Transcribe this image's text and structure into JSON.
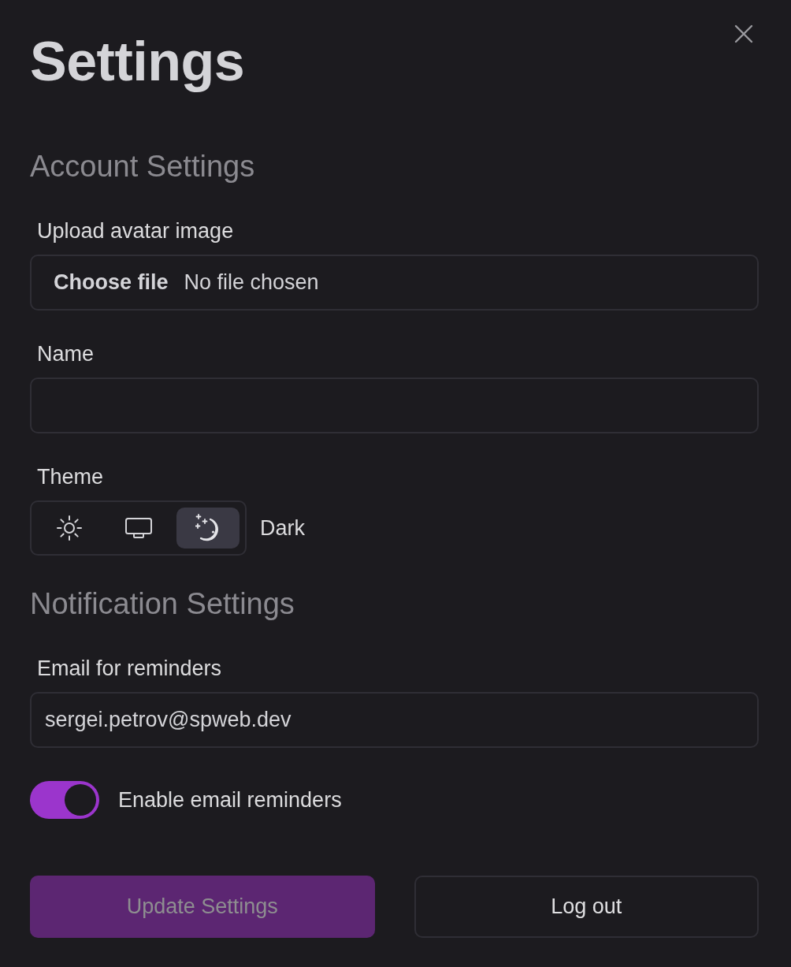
{
  "dialog": {
    "title": "Settings"
  },
  "sections": [
    {
      "heading": "Account Settings",
      "fields": [
        {
          "kind": "file",
          "label": "Upload avatar image",
          "button": "Choose file",
          "status": "No file chosen"
        },
        {
          "kind": "text",
          "label": "Name"
        },
        {
          "kind": "theme",
          "label": "Theme",
          "options": [
            {
              "kind": "sun",
              "selected": false
            },
            {
              "kind": "monitor",
              "selected": false
            },
            {
              "kind": "moon",
              "selected": true
            }
          ],
          "value": "Dark"
        }
      ]
    },
    {
      "heading": "Notification Settings",
      "fields": [
        {
          "kind": "text",
          "label": "Email for reminders",
          "value": "sergei.petrov@spweb.dev"
        },
        {
          "kind": "toggle",
          "label": "Enable email reminders",
          "on": true
        }
      ]
    }
  ],
  "buttons": [
    {
      "kind": "primary",
      "label": "Update Settings",
      "disabled": true
    },
    {
      "kind": "secondary",
      "label": "Log out",
      "disabled": false
    }
  ]
}
